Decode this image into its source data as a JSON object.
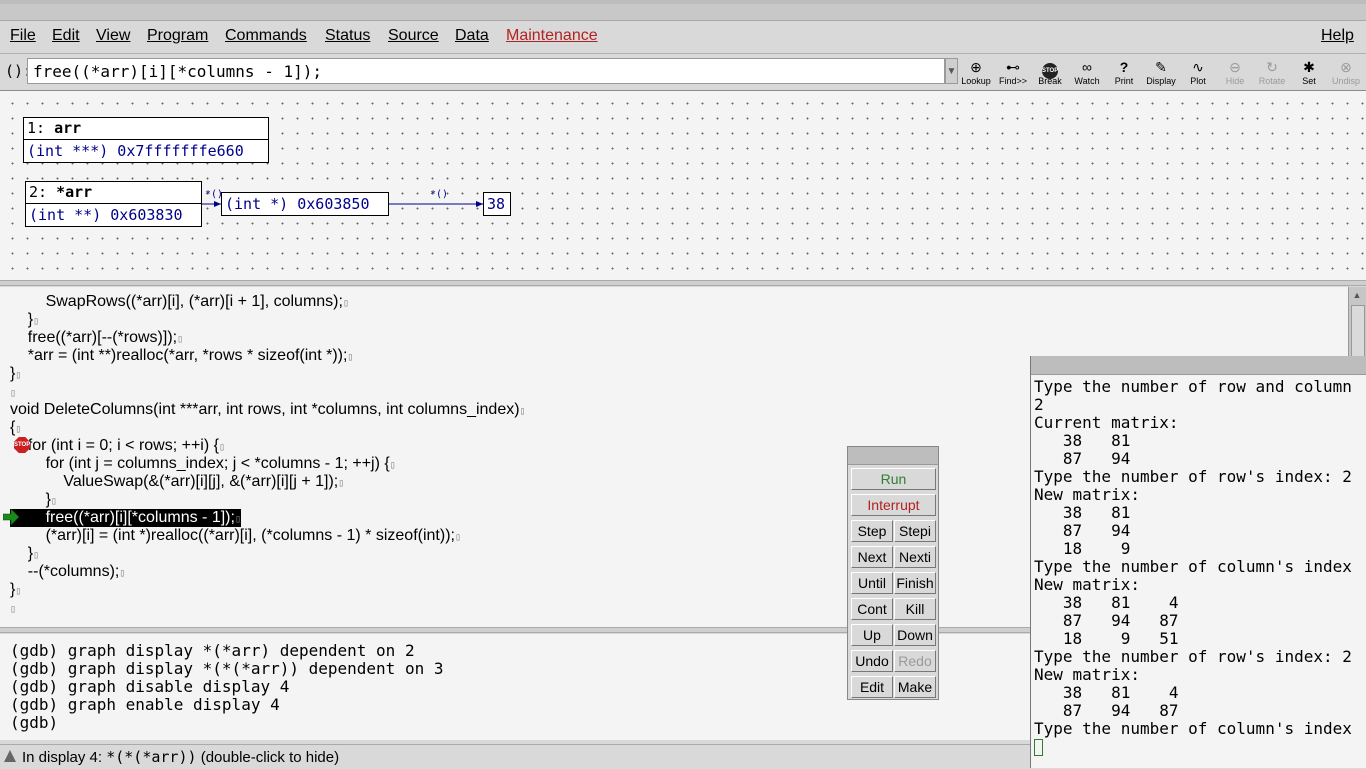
{
  "menu": {
    "file": "File",
    "edit": "Edit",
    "view": "View",
    "program": "Program",
    "commands": "Commands",
    "status": "Status",
    "source": "Source",
    "data": "Data",
    "maintenance": "Maintenance",
    "help": "Help"
  },
  "argbar": {
    "label": "():",
    "value": "free((*arr)[i][*columns - 1]);",
    "tools": [
      "Lookup",
      "Find>>",
      "Break",
      "Watch",
      "Print",
      "Display",
      "Plot",
      "Hide",
      "Rotate",
      "Set",
      "Undisp"
    ],
    "break_icon_text": "STOP"
  },
  "displays": {
    "d1": {
      "title_num": "1:",
      "title_expr": "arr",
      "value": "(int ***) 0x7fffffffe660"
    },
    "d2": {
      "title_num": "2:",
      "title_expr": "*arr",
      "value": "(int **) 0x603830"
    },
    "d3": {
      "value": "(int *) 0x603850"
    },
    "d4": {
      "value": "38"
    },
    "edge_label": "*()"
  },
  "source": {
    "lines": [
      "        SwapRows((*arr)[i], (*arr)[i + 1], columns);",
      "    }",
      "    free((*arr)[--(*rows)]);",
      "    *arr = (int **)realloc(*arr, *rows * sizeof(int *));",
      "}",
      "",
      "void DeleteColumns(int ***arr, int rows, int *columns, int columns_index)",
      "{",
      "    for (int i = 0; i < rows; ++i) {",
      "        for (int j = columns_index; j < *columns - 1; ++j) {",
      "            ValueSwap(&(*arr)[i][j], &(*arr)[i][j + 1]);",
      "        }",
      "        free((*arr)[i][*columns - 1]);",
      "        (*arr)[i] = (int *)realloc((*arr)[i], (*columns - 1) * sizeof(int));",
      "    }",
      "    --(*columns);",
      "}",
      ""
    ],
    "stop_icon_text": "STOP"
  },
  "console": {
    "lines": [
      "(gdb) graph display *(*arr) dependent on 2",
      "(gdb) graph display *(*(*arr)) dependent on 3",
      "(gdb) graph disable display 4",
      "(gdb) graph enable display 4",
      "(gdb)"
    ]
  },
  "status": {
    "prefix": "In display 4: ",
    "expr": "*(*(*arr))",
    "suffix": " (double-click to hide)"
  },
  "cmdtool": {
    "run": "Run",
    "interrupt": "Interrupt",
    "step": "Step",
    "stepi": "Stepi",
    "next": "Next",
    "nexti": "Nexti",
    "until": "Until",
    "finish": "Finish",
    "cont": "Cont",
    "kill": "Kill",
    "up": "Up",
    "down": "Down",
    "undo": "Undo",
    "redo": "Redo",
    "edit": "Edit",
    "make": "Make"
  },
  "exec": {
    "lines": [
      "Type the number of row and column",
      "2",
      "Current matrix:",
      "   38   81",
      "   87   94",
      "Type the number of row's index: 2",
      "New matrix:",
      "   38   81",
      "   87   94",
      "   18    9",
      "Type the number of column's index",
      "New matrix:",
      "   38   81    4",
      "   87   94   87",
      "   18    9   51",
      "Type the number of row's index: 2",
      "New matrix:",
      "   38   81    4",
      "   87   94   87",
      "Type the number of column's index"
    ]
  }
}
